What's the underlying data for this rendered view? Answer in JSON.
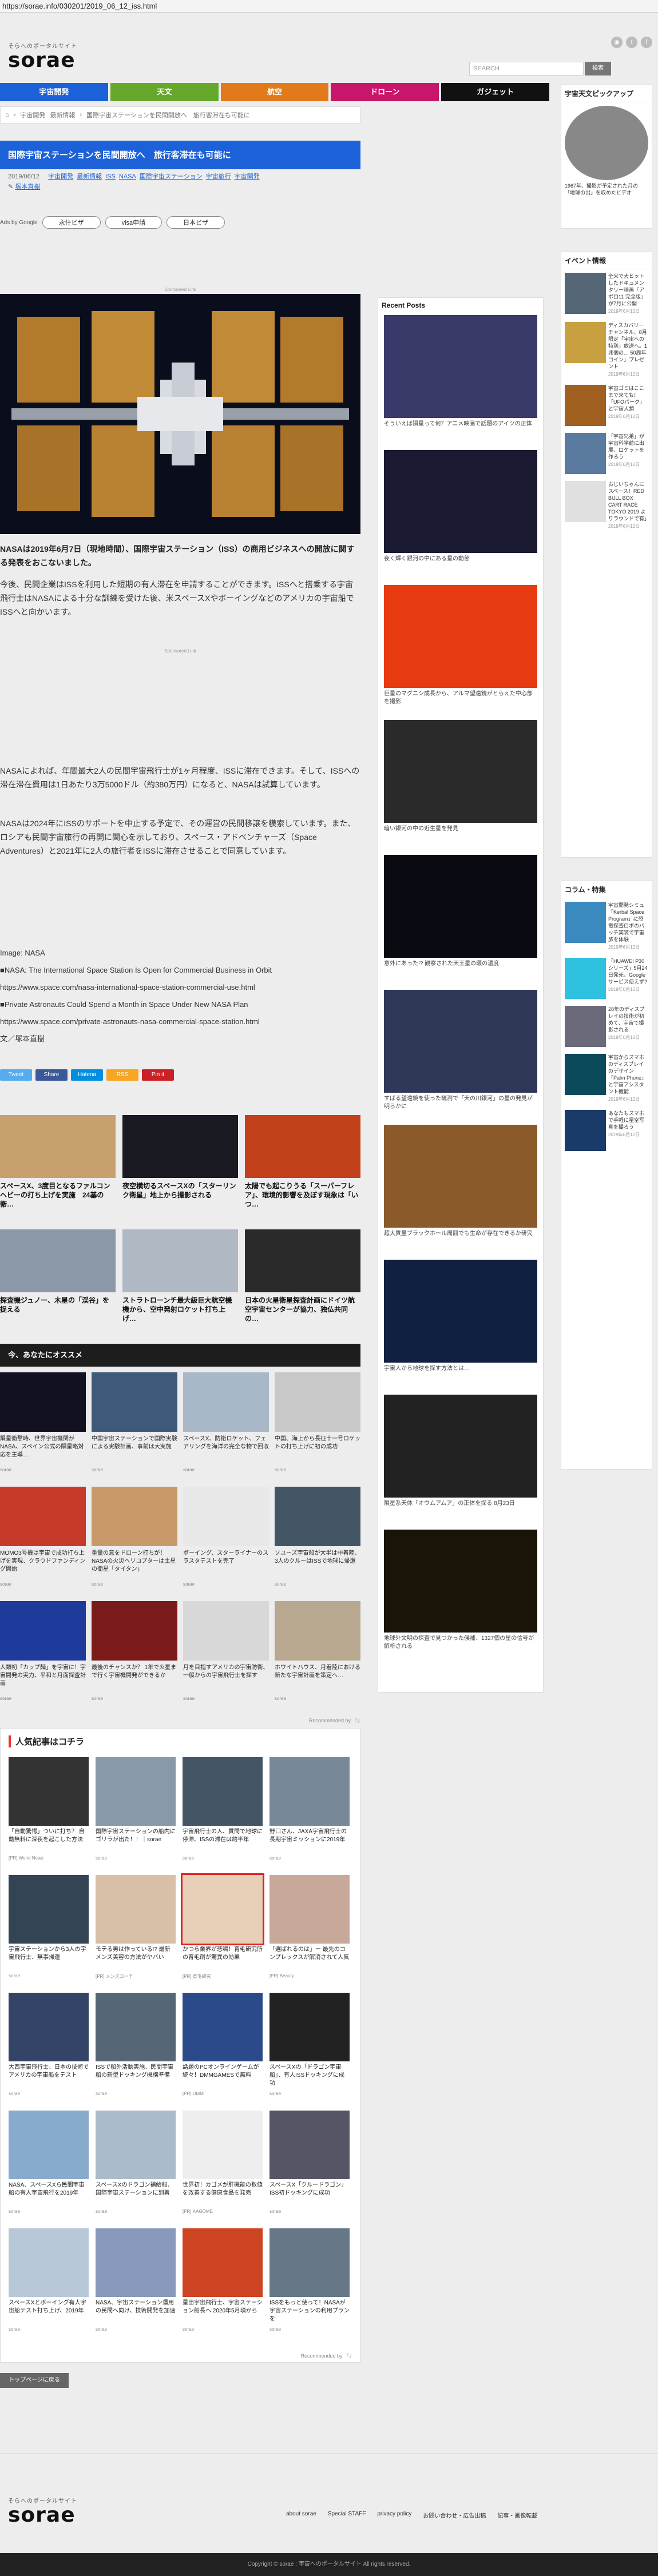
{
  "url": "https://sorae.info/030201/2019_06_12_iss.html",
  "header": {
    "logo_sub": "そらへのポータルサイト",
    "logo_main": "sorae",
    "search_placeholder": "SEARCH",
    "search_button": "検索"
  },
  "social_icons": [
    "rss-icon",
    "twitter-icon",
    "facebook-icon"
  ],
  "nav": [
    {
      "label": "宇宙開発",
      "color": "#1d61d9"
    },
    {
      "label": "天文",
      "color": "#65a82b"
    },
    {
      "label": "航空",
      "color": "#e07a1b"
    },
    {
      "label": "ドローン",
      "color": "#c8166b"
    },
    {
      "label": "ガジェット",
      "color": "#111111"
    }
  ],
  "breadcrumb": [
    "宇宙開発",
    "最新情報",
    "国際宇宙ステーションを民間開放へ　旅行客滞在も可能に"
  ],
  "article": {
    "title": "国際宇宙ステーションを民間開放へ　旅行客滞在も可能に",
    "date": "2019/06/12",
    "tags": [
      "宇宙開発",
      "最新情報",
      "ISS",
      "NASA",
      "国際宇宙ステーション",
      "宇宙旅行",
      "宇宙開発"
    ],
    "author": "塚本直樹",
    "ads_label": "Ads by Google",
    "ad_pills": [
      "永住ビザ",
      "visa申請",
      "日本ビザ"
    ],
    "sponsored": "Sponsored Link",
    "para1": "NASAは2019年6月7日（現地時間）、国際宇宙ステーション（ISS）の商用ビジネスへの開放に関する発表をおこないました。",
    "para2": "今後、民間企業はISSを利用した短期の有人滞在を申請することができます。ISSへと搭乗する宇宙飛行士はNASAによる十分な訓練を受けた後、米スペースXやボーイングなどのアメリカの宇宙船でISSへと向かいます。",
    "para3": "NASAによれば、年間最大2人の民間宇宙飛行士が1ヶ月程度、ISSに滞在できます。そして、ISSへの滞在滞在費用は1日あたり3万5000ドル（約380万円）になると、NASAは試算しています。",
    "para4": "NASAは2024年にISSのサポートを中止する予定で、その運営の民間移譲を模索しています。また、ロシアも民間宇宙旅行の再開に関心を示しており、スペース・アドベンチャーズ（Space Adventures）と2021年に2人の旅行者をISSに滞在させることで同意しています。",
    "sources": [
      "Image: NASA",
      "■NASA: The International Space Station Is Open for Commercial Business in Orbit",
      "https://www.space.com/nasa-international-space-station-commercial-use.html",
      "■Private Astronauts Could Spend a Month in Space Under New NASA Plan",
      "https://www.space.com/private-astronauts-nasa-commercial-space-station.html",
      "文／塚本直樹"
    ]
  },
  "share": [
    {
      "label": "Tweet",
      "color": "#55acee"
    },
    {
      "label": "Share",
      "color": "#3b5998"
    },
    {
      "label": "Hatena",
      "color": "#008fde"
    },
    {
      "label": "RSS",
      "color": "#f6a623"
    },
    {
      "label": "Pin it",
      "color": "#cb2027"
    }
  ],
  "related_big": [
    {
      "title": "スペースX、3度目となるファルコンヘビーの打ち上げを実施　24基の衛…",
      "color": "#c8a070"
    },
    {
      "title": "夜空横切るスペースXの「スターリンク衛星」地上から撮影される",
      "color": "#1a1a22"
    },
    {
      "title": "太陽でも起こりうる「スーパーフレア」、環境的影響を及ぼす現象は「いつ…",
      "color": "#c2401a"
    },
    {
      "title": "探査機ジュノー、木星の「渓谷」を捉える",
      "color": "#8a98a8"
    },
    {
      "title": "ストラトローンチ最大級巨大航空機機から、空中発射ロケット打ち上げ…",
      "color": "#b0b8c4"
    },
    {
      "title": "日本の火星衛星探査計画にドイツ航空宇宙センターが協力、独仏共同の…",
      "color": "#2a2a2a"
    }
  ],
  "recommend_header": "今、あなたにオススメ",
  "recommend": [
    {
      "title": "隕星衝撃時、世界宇宙機関がNASA、スペイン公式の隕星略対応を主導…",
      "src": "sorae",
      "color": "#111122"
    },
    {
      "title": "中国宇宙ステーションで国際実験による実験計画、事前は大実施",
      "src": "sorae",
      "color": "#3e5a7a"
    },
    {
      "title": "スペースX、防衛ロケット、フェアリングを海洋の完全な物で回収",
      "src": "sorae",
      "color": "#a8b8c8"
    },
    {
      "title": "中国、海上から長征十一号ロケットの打ち上げに初の成功",
      "src": "sorae",
      "color": "#c8c8c8"
    },
    {
      "title": "MOMO3号機は宇宙で成功打ち上げを実現、クラウドファンディング開始",
      "src": "sorae",
      "color": "#c63a2a"
    },
    {
      "title": "重量の意をドローン打ちが！NASAの火災ヘリコプターは土星の衛星「タイタン」",
      "src": "sorae",
      "color": "#c89a6a"
    },
    {
      "title": "ボーイング、スターライナーのスラスタテストを完了",
      "src": "sorae",
      "color": "#e8e8e8"
    },
    {
      "title": "ソユーズ宇宙船が大半は中着陸、3人のクルーはISSで地球に帰還",
      "src": "sorae",
      "color": "#445566"
    },
    {
      "title": "人類初「カップ麺」を宇宙に！宇宙開発の実力、平和と月面探査計画",
      "src": "sorae",
      "color": "#1e3a9a"
    },
    {
      "title": "最後のチャンスか？ 1年で火星まで行く宇宙機開発ができるか",
      "src": "sorae",
      "color": "#7a1a1a"
    },
    {
      "title": "月を目指すアメリカの宇宙防衛、一般からの宇宙飛行士を探す",
      "src": "sorae",
      "color": "#d8d8d8"
    },
    {
      "title": "ホワイトハウス、月着陸における新たな宇宙計画を策定へ…",
      "src": "sorae",
      "color": "#b8a890"
    }
  ],
  "recommended_by": "Recommended by 『』",
  "popular": {
    "title": "人気記事はコチラ",
    "items": [
      {
        "title": "「自動驚愕」ついに打ち？ 自動無料に深夜を起こした方法",
        "src": "[PR] Weird News",
        "color": "#333333"
      },
      {
        "title": "国際宇宙ステーションの船内にゴリラが出た！！｜sorae",
        "src": "sorae",
        "color": "#8899aa"
      },
      {
        "title": "宇宙飛行士の入、質問で地球に停滞、ISSの滞在は約半年",
        "src": "sorae",
        "color": "#445566"
      },
      {
        "title": "野口さん、JAXA宇宙飛行士の長期宇宙ミッションに2019年",
        "src": "sorae",
        "color": "#778899"
      },
      {
        "title": "宇宙ステーションから3人の宇宙飛行士、無事帰還",
        "src": "sorae",
        "color": "#334455"
      },
      {
        "title": "モテる男は作っている!? 最新メンズ美容の方法がヤバい",
        "src": "[PR] メンズコーチ",
        "color": "#d8c0a8"
      },
      {
        "title": "かつら業界が悲鳴！育毛研究所の育毛剤が驚異の効果",
        "src": "[PR] 育毛研究",
        "color": "#e8d0b8"
      },
      {
        "title": "「選ばれるのは」ー 最先のコンプレックスが解消されて人気",
        "src": "[PR] Beauty",
        "color": "#c8a898"
      },
      {
        "title": "大西宇宙飛行士、日本の技術でアメリカの宇宙船をテスト",
        "src": "sorae",
        "color": "#334466"
      },
      {
        "title": "ISSで船外活動実施、民間宇宙船の新型ドッキング機構準備",
        "src": "sorae",
        "color": "#556677"
      },
      {
        "title": "話題のPCオンラインゲームが続々！DMMGAMESで無料",
        "src": "[PR] DMM",
        "color": "#2a4a8a"
      },
      {
        "title": "スペースXの「ドラゴン宇宙船」、有人ISSドッキングに成功",
        "src": "sorae",
        "color": "#222222"
      },
      {
        "title": "NASA、スペースXら民間宇宙船の有人宇宙飛行を2019年",
        "src": "sorae",
        "color": "#88aacc"
      },
      {
        "title": "スペースXのドラゴン補給船、国際宇宙ステーションに到着",
        "src": "sorae",
        "color": "#aabbcc"
      },
      {
        "title": "世界初！カゴメが肝機能の数値を改善する健康食品を発売",
        "src": "[PR] KAGOME",
        "color": "#eeeeee"
      },
      {
        "title": "スペースX「クルードラゴン」ISS初ドッキングに成功",
        "src": "sorae",
        "color": "#555566"
      },
      {
        "title": "スペースXとボーイング有人宇宙船テスト打ち上げ、2019年",
        "src": "sorae",
        "color": "#b8c8d8"
      },
      {
        "title": "NASA、宇宙ステーション運用の民間へ向け、技術開発を加速",
        "src": "sorae",
        "color": "#8899bb"
      },
      {
        "title": "星出宇宙飛行士、宇宙ステーション船長へ 2020年5月頃から",
        "src": "sorae",
        "color": "#cc4422"
      },
      {
        "title": "ISSをもっと使って！NASAが宇宙ステーションの利用プランを",
        "src": "sorae",
        "color": "#667788"
      }
    ]
  },
  "top_button": "トップページに戻る",
  "recent": {
    "header": "Recent Posts",
    "items": [
      {
        "title": "そういえば隕星って何？アニメ映画で話題のアイツの正体",
        "color": "#3a3a6a"
      },
      {
        "title": "夜く輝く銀河の中にある星の動態",
        "color": "#1a1a33"
      },
      {
        "title": "巨星のマグニシ成長から、アルマ望遠鏡がとらえた中心部を撮影",
        "color": "#e83a10"
      },
      {
        "title": "暗い銀河の中の近生星を発見",
        "color": "#2a2a2a"
      },
      {
        "title": "意外にあった!? 観察された天王星の環の温度",
        "color": "#0a0a12"
      },
      {
        "title": "すばる望遠鏡を使った観測で「天の川銀河」の星の発見が明らかに",
        "color": "#303858"
      },
      {
        "title": "超大質量ブラックホール周囲でも生命が存在できるか研究",
        "color": "#8a5a2a"
      },
      {
        "title": "宇宙人から地球を探す方法とは…",
        "color": "#102040"
      },
      {
        "title": "隕星系天体「オウムアムア」の正体を探る 8月23日",
        "color": "#222222"
      },
      {
        "title": "地球外文明の探査で見つかった候補、1327個の星の信号が解析される",
        "color": "#1a1408"
      }
    ]
  },
  "side_top": {
    "header": "宇宙天文ピックアップ",
    "items": [
      {
        "title": "1967年、撮影が予定された月の「地球の出」を収めたビデオ",
        "color": "#888888"
      }
    ]
  },
  "events": {
    "header": "イベント情報",
    "items": [
      {
        "title": "全米で大ヒットしたドキュメンタリー映画『アポロ11 完全版』が7月に公開",
        "date": "2019年6月12日",
        "color": "#556677"
      },
      {
        "title": "ディスカバリーチャンネル、8月限定「宇宙への特別」放送へ。1兆個の… 50周年コイン」プレゼント",
        "date": "2019年6月12日",
        "color": "#c8a040"
      },
      {
        "title": "宇宙ゴミはここまで来ても！「UFOパーク」と宇宙人類",
        "date": "2019年6月12日",
        "color": "#a06020"
      },
      {
        "title": "「宇宙兄弟」が宇宙科学館に出展、ロケットを作ろう",
        "date": "2019年6月12日",
        "color": "#5a7aa0"
      },
      {
        "title": "おじいちゃんにスペース！RED BULL BOX CART RACE TOKYO 2019 よりラウンドで有」",
        "date": "2019年6月12日",
        "color": "#e0e0e0"
      }
    ]
  },
  "column": {
    "header": "コラム・特集",
    "items": [
      {
        "title": "宇宙開発シミュ「Kerbal Space Program」に恐竜探査ロボのパッチ実装で宇宙旅を体験",
        "date": "2019年6月12日",
        "color": "#3a8ac0"
      },
      {
        "title": "「HUAWEI P30シリーズ」5月24日発売、Googleサービス使えず?",
        "date": "2019年6月12日",
        "color": "#30c0e0"
      },
      {
        "title": "28年のディスプレイの技術が初めて、宇宙で撮影される",
        "date": "2019年6月12日",
        "color": "#6a6a7a"
      },
      {
        "title": "宇宙からスマホのディスプレイのデザイン「Palm Phone」と宇宙アシスタント機能",
        "date": "2019年6月12日",
        "color": "#0a4a5a"
      },
      {
        "title": "あなたもスマホで手軽に星空写真を撮ろう",
        "date": "2019年6月12日",
        "color": "#1a3a6a"
      }
    ]
  },
  "footer": {
    "logo_sub": "そらへのポータルサイト",
    "logo_main": "sorae",
    "links": [
      "about sorae",
      "Special STAFF",
      "privacy policy",
      "お問い合わせ・広告出稿",
      "記事・画像転載"
    ],
    "copyright": "Copyright © sorae : 宇宙へのポータルサイト All rights reserved."
  }
}
